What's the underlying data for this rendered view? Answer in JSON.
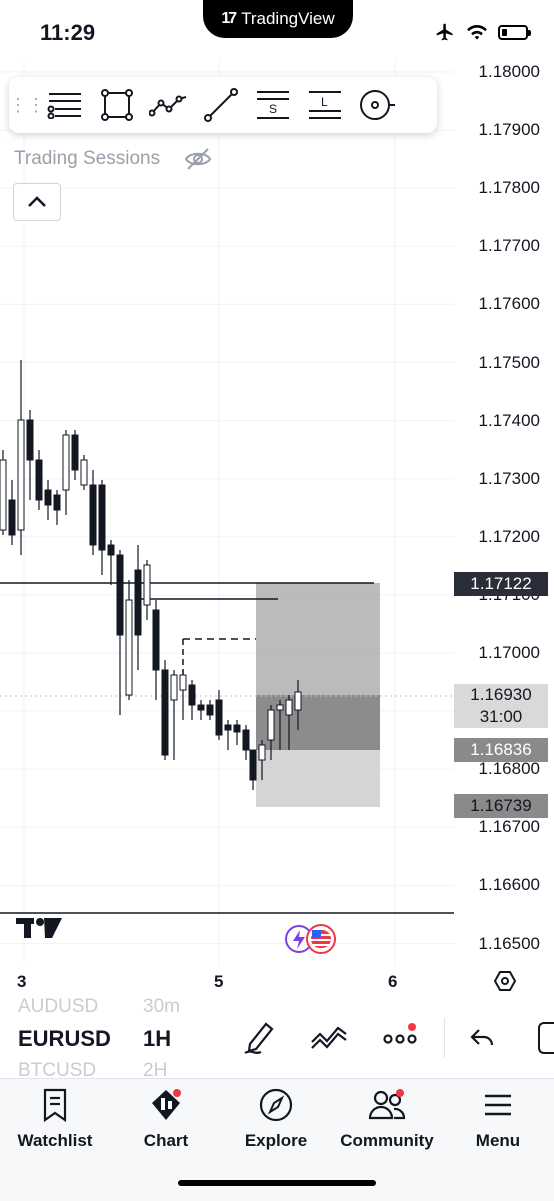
{
  "status_bar": {
    "time": "11:29",
    "app_banner": "TradingView",
    "battery_level": 0.22
  },
  "drawing_toolbar": {
    "tools": [
      "trend-lines-icon",
      "rectangle-icon",
      "path-icon",
      "line-icon",
      "short-position-icon",
      "long-position-icon",
      "brush-icon"
    ]
  },
  "indicator_label": "Trading Sessions",
  "price_axis": {
    "ticks": [
      "1.18000",
      "1.17900",
      "1.17800",
      "1.17700",
      "1.17600",
      "1.17500",
      "1.17400",
      "1.17300",
      "1.17200",
      "1.17100",
      "1.17000",
      "1.16900",
      "1.16800",
      "1.16700",
      "1.16600",
      "1.16500"
    ]
  },
  "price_tags": {
    "level_line": "1.17122",
    "last_price": "1.16930",
    "countdown": "31:00",
    "stop_level": "1.16836",
    "target_level": "1.16739"
  },
  "time_axis": {
    "labels": [
      "3",
      "5",
      "6"
    ]
  },
  "symbol_bar": {
    "prev_symbol": "AUDUSD",
    "prev_interval": "30m",
    "symbol": "EURUSD",
    "interval": "1H",
    "next_symbol": "BTCUSD",
    "next_interval": "2H"
  },
  "tabbar": {
    "items": [
      {
        "label": "Watchlist",
        "icon": "bookmark-icon"
      },
      {
        "label": "Chart",
        "icon": "chart-icon"
      },
      {
        "label": "Explore",
        "icon": "compass-icon"
      },
      {
        "label": "Community",
        "icon": "people-icon"
      },
      {
        "label": "Menu",
        "icon": "hamburger-icon"
      }
    ]
  },
  "colors": {
    "bull": "#ffffff",
    "bear": "#131722",
    "accent_red": "#f23645",
    "tag_dark": "#2a2e39",
    "tag_grey": "#8a8a8a"
  }
}
